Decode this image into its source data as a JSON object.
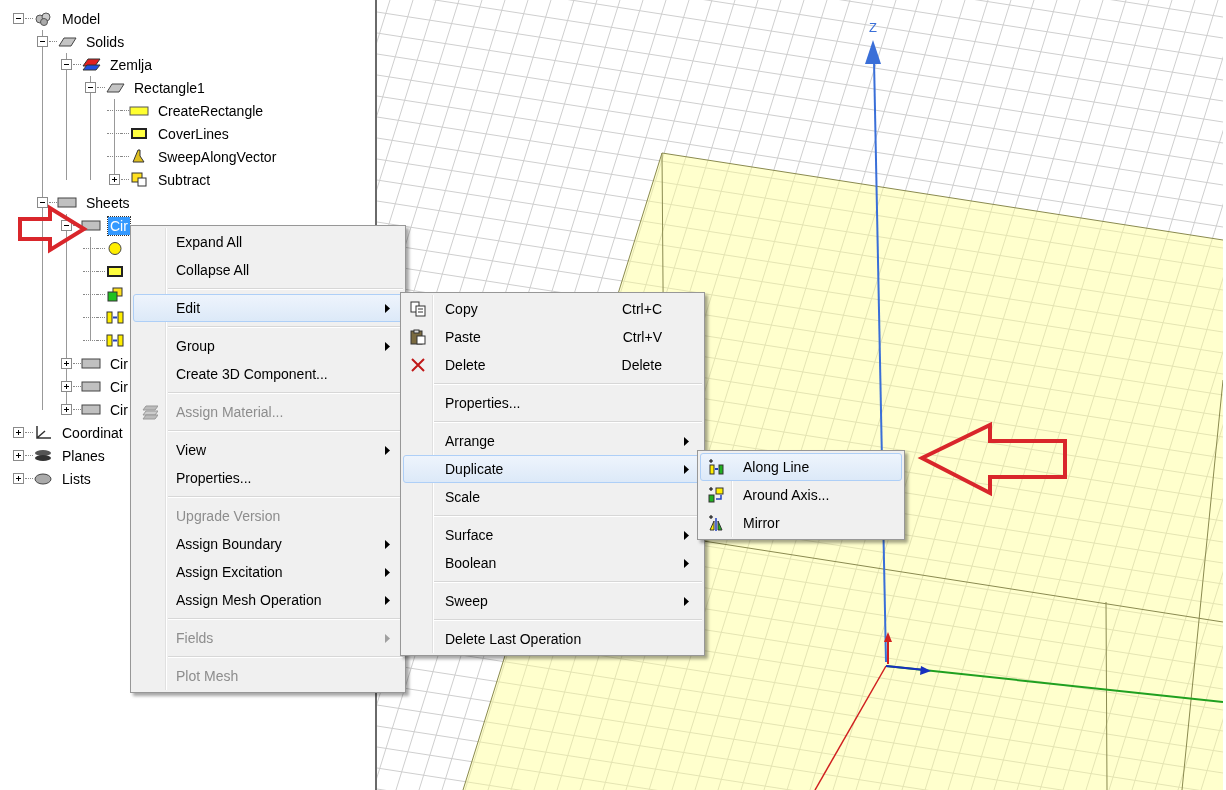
{
  "tree": {
    "nodes": [
      {
        "label": "Model",
        "kind": "model",
        "expanded": true,
        "selected": false,
        "children": [
          {
            "label": "Solids",
            "kind": "solid",
            "expanded": true,
            "selected": false,
            "children": [
              {
                "label": "Zemlja",
                "kind": "layered",
                "expanded": true,
                "selected": false,
                "children": [
                  {
                    "label": "Rectangle1",
                    "kind": "solid",
                    "expanded": true,
                    "selected": false,
                    "children": [
                      {
                        "label": "CreateRectangle",
                        "kind": "rectangle",
                        "selected": false
                      },
                      {
                        "label": "CoverLines",
                        "kind": "framed",
                        "selected": false
                      },
                      {
                        "label": "SweepAlongVector",
                        "kind": "sweep",
                        "selected": false
                      },
                      {
                        "label": "Subtract",
                        "kind": "subtract",
                        "expanded": false,
                        "selected": false
                      }
                    ]
                  }
                ]
              }
            ]
          },
          {
            "label": "Sheets",
            "kind": "sheet",
            "expanded": true,
            "selected": false,
            "children": [
              {
                "label": "Cir",
                "kind": "sheet",
                "expanded": true,
                "selected": true,
                "children": [
                  {
                    "kind": "circle",
                    "selected": false
                  },
                  {
                    "kind": "framed",
                    "selected": false
                  },
                  {
                    "kind": "squares",
                    "selected": false
                  },
                  {
                    "kind": "move",
                    "selected": false
                  },
                  {
                    "kind": "move",
                    "selected": false
                  }
                ]
              },
              {
                "label": "Cir",
                "kind": "sheet",
                "expanded": false,
                "selected": false
              },
              {
                "label": "Cir",
                "kind": "sheet",
                "expanded": false,
                "selected": false
              },
              {
                "label": "Cir",
                "kind": "sheet",
                "expanded": false,
                "selected": false
              }
            ]
          }
        ]
      },
      {
        "label": "Coordinat",
        "kind": "coordinate",
        "expanded": false,
        "selected": false
      },
      {
        "label": "Planes",
        "kind": "planes",
        "expanded": false,
        "selected": false
      },
      {
        "label": "Lists",
        "kind": "lists",
        "expanded": false,
        "selected": false
      }
    ]
  },
  "context_menu": {
    "groups": [
      [
        {
          "label": "Expand All",
          "kind": "plain",
          "selected": false,
          "disabled": false,
          "submenu": false
        },
        {
          "label": "Collapse All",
          "kind": "plain",
          "selected": false,
          "disabled": false,
          "submenu": false
        }
      ],
      [
        {
          "label": "Edit",
          "kind": "plain",
          "selected": true,
          "disabled": false,
          "submenu": true
        }
      ],
      [
        {
          "label": "Group",
          "kind": "plain",
          "selected": false,
          "disabled": false,
          "submenu": true
        },
        {
          "label": "Create 3D Component...",
          "kind": "plain",
          "selected": false,
          "disabled": false,
          "submenu": false
        }
      ],
      [
        {
          "label": "Assign Material...",
          "kind": "material",
          "selected": false,
          "disabled": true,
          "submenu": false
        }
      ],
      [
        {
          "label": "View",
          "kind": "plain",
          "selected": false,
          "disabled": false,
          "submenu": true
        },
        {
          "label": "Properties...",
          "kind": "plain",
          "selected": false,
          "disabled": false,
          "submenu": false
        }
      ],
      [
        {
          "label": "Upgrade Version",
          "kind": "plain",
          "selected": false,
          "disabled": true,
          "submenu": false
        },
        {
          "label": "Assign Boundary",
          "kind": "plain",
          "selected": false,
          "disabled": false,
          "submenu": true
        },
        {
          "label": "Assign Excitation",
          "kind": "plain",
          "selected": false,
          "disabled": false,
          "submenu": true
        },
        {
          "label": "Assign Mesh Operation",
          "kind": "plain",
          "selected": false,
          "disabled": false,
          "submenu": true
        }
      ],
      [
        {
          "label": "Fields",
          "kind": "plain",
          "selected": false,
          "disabled": true,
          "submenu": true
        }
      ],
      [
        {
          "label": "Plot Mesh",
          "kind": "plain",
          "selected": false,
          "disabled": true,
          "submenu": false
        }
      ]
    ]
  },
  "edit_submenu": {
    "groups": [
      [
        {
          "label": "Copy",
          "kind": "copy",
          "shortcut": "Ctrl+C",
          "selected": false,
          "disabled": false,
          "submenu": false
        },
        {
          "label": "Paste",
          "kind": "paste",
          "shortcut": "Ctrl+V",
          "selected": false,
          "disabled": false,
          "submenu": false
        },
        {
          "label": "Delete",
          "kind": "delete",
          "shortcut": "Delete",
          "selected": false,
          "disabled": false,
          "submenu": false
        }
      ],
      [
        {
          "label": "Properties...",
          "kind": "plain",
          "selected": false,
          "disabled": false,
          "submenu": false
        }
      ],
      [
        {
          "label": "Arrange",
          "kind": "plain",
          "selected": false,
          "disabled": false,
          "submenu": true
        },
        {
          "label": "Duplicate",
          "kind": "plain",
          "selected": true,
          "disabled": false,
          "submenu": true
        },
        {
          "label": "Scale",
          "kind": "plain",
          "selected": false,
          "disabled": false,
          "submenu": false
        }
      ],
      [
        {
          "label": "Surface",
          "kind": "plain",
          "selected": false,
          "disabled": false,
          "submenu": true
        },
        {
          "label": "Boolean",
          "kind": "plain",
          "selected": false,
          "disabled": false,
          "submenu": true
        }
      ],
      [
        {
          "label": "Sweep",
          "kind": "plain",
          "selected": false,
          "disabled": false,
          "submenu": true
        }
      ],
      [
        {
          "label": "Delete Last Operation",
          "kind": "plain",
          "selected": false,
          "disabled": false,
          "submenu": false
        }
      ]
    ]
  },
  "duplicate_submenu": {
    "groups": [
      [
        {
          "label": "Along Line",
          "kind": "along-line",
          "selected": true,
          "disabled": false,
          "submenu": false
        },
        {
          "label": "Around Axis...",
          "kind": "around-axis",
          "selected": false,
          "disabled": false,
          "submenu": false
        },
        {
          "label": "Mirror",
          "kind": "mirror",
          "selected": false,
          "disabled": false,
          "submenu": false
        }
      ]
    ]
  },
  "viewport": {
    "axis_label": "Z"
  }
}
